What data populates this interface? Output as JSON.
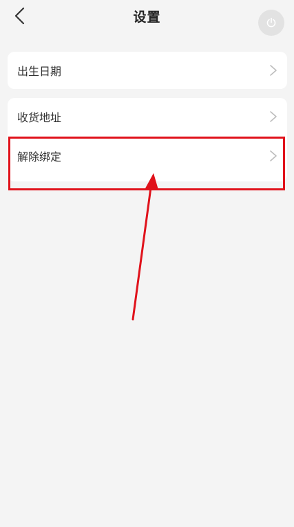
{
  "header": {
    "title": "设置",
    "back_icon": "chevron-left-icon",
    "power_icon": "power-icon"
  },
  "settings": {
    "group1": [
      {
        "label": "出生日期",
        "icon": "chevron-right-icon"
      }
    ],
    "group2": [
      {
        "label": "收货地址",
        "icon": "chevron-right-icon"
      },
      {
        "label": "解除绑定",
        "icon": "chevron-right-icon"
      }
    ]
  },
  "annotation": {
    "highlight_color": "#e0121b",
    "arrow_color": "#e0121b"
  },
  "colors": {
    "background": "#f4f4f4",
    "card": "#ffffff",
    "text": "#333333",
    "chevron": "#bdbdbd"
  }
}
